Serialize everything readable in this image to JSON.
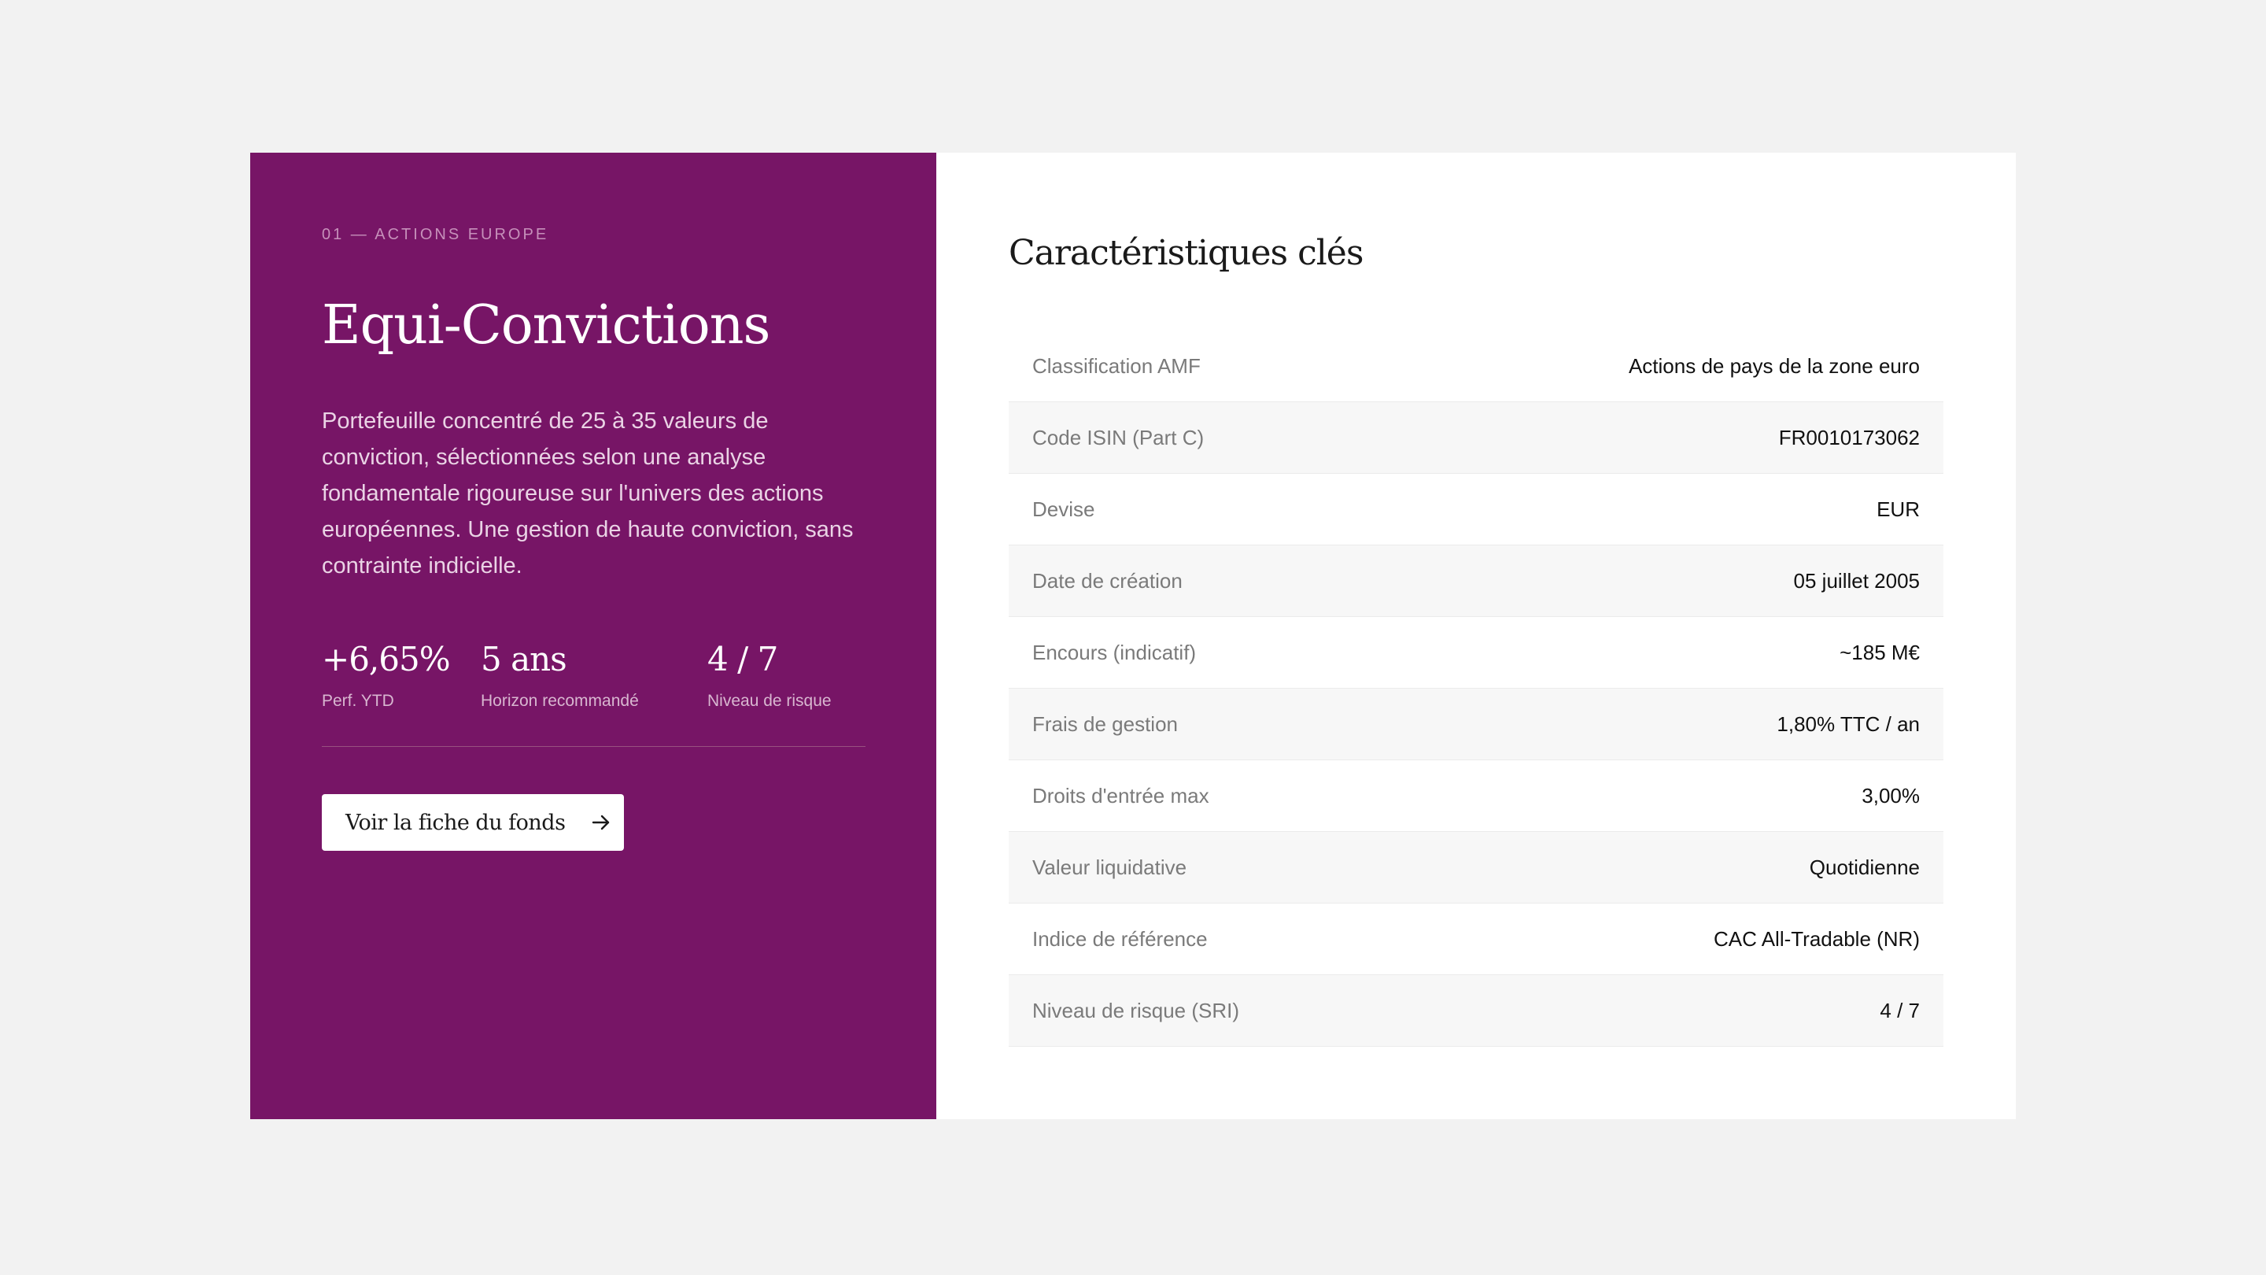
{
  "fund": {
    "eyebrow": "01 — ACTIONS EUROPE",
    "title": "Equi-Convictions",
    "description": "Portefeuille concentré de 25 à 35 valeurs de conviction, sélectionnées selon une analyse fondamentale rigoureuse sur l'univers des actions européennes. Une gestion de haute conviction, sans contrainte indicielle.",
    "stats": [
      {
        "value": "+6,65%",
        "label": "Perf. YTD"
      },
      {
        "value": "5 ans",
        "label": "Horizon recommandé"
      },
      {
        "value": "4 / 7",
        "label": "Niveau de risque"
      }
    ],
    "cta_label": "Voir la fiche du fonds",
    "cta_icon": "arrow-right-icon"
  },
  "characteristics": {
    "title": "Caractéristiques clés",
    "rows": [
      {
        "label": "Classification AMF",
        "value": "Actions de pays de la zone euro"
      },
      {
        "label": "Code ISIN (Part C)",
        "value": "FR0010173062"
      },
      {
        "label": "Devise",
        "value": "EUR"
      },
      {
        "label": "Date de création",
        "value": "05 juillet 2005"
      },
      {
        "label": "Encours (indicatif)",
        "value": "~185 M€"
      },
      {
        "label": "Frais de gestion",
        "value": "1,80% TTC / an"
      },
      {
        "label": "Droits d'entrée max",
        "value": "3,00%"
      },
      {
        "label": "Valeur liquidative",
        "value": "Quotidienne"
      },
      {
        "label": "Indice de référence",
        "value": "CAC All-Tradable (NR)"
      },
      {
        "label": "Niveau de risque (SRI)",
        "value": "4 / 7"
      }
    ]
  },
  "colors": {
    "accent": "#771566",
    "background": "#f2f2f2",
    "card": "#ffffff",
    "row_alt": "#f7f7f7"
  }
}
